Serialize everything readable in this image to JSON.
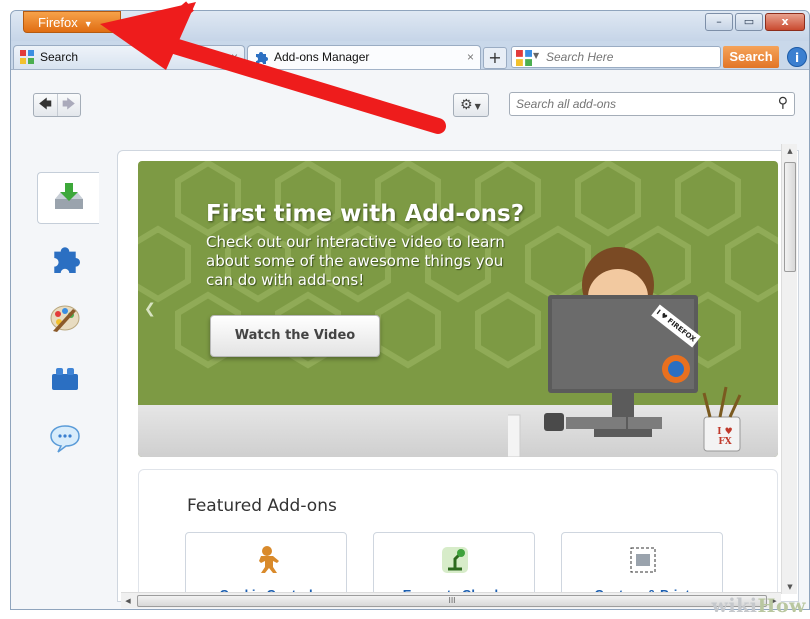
{
  "window": {
    "app_button_label": "Firefox",
    "controls": {
      "minimize": "–",
      "maximize": "▭",
      "close": "x"
    }
  },
  "tabs": [
    {
      "label": "Search",
      "active": false,
      "icon": "search-engine-icon"
    },
    {
      "label": "Add-ons Manager",
      "active": true,
      "icon": "puzzle-piece-icon"
    }
  ],
  "toolbar": {
    "search_placeholder": "Search Here",
    "search_button_label": "Search",
    "info_label": "i"
  },
  "addons": {
    "search_placeholder": "Search all add-ons",
    "categories": [
      {
        "name": "get-add-ons",
        "icon": "download-tray-icon",
        "selected": true
      },
      {
        "name": "extensions",
        "icon": "puzzle-piece-icon",
        "selected": false
      },
      {
        "name": "appearance",
        "icon": "palette-icon",
        "selected": false
      },
      {
        "name": "plugins",
        "icon": "lego-brick-icon",
        "selected": false
      },
      {
        "name": "services",
        "icon": "speech-bubble-icon",
        "selected": false
      }
    ],
    "banner": {
      "title": "First time with Add-ons?",
      "description": "Check out our interactive video to learn about some of the awesome things you can do with add-ons!",
      "button_label": "Watch the Video",
      "sticker_text": "I ♥ FIREFOX",
      "mug_text": "I ♥ FX"
    },
    "featured": {
      "heading": "Featured Add-ons",
      "items": [
        {
          "name": "Cookie Control",
          "icon": "gingerbread-icon"
        },
        {
          "name": "Evernote Clearly",
          "icon": "desk-lamp-icon"
        },
        {
          "name": "Capture & Print",
          "icon": "capture-icon"
        }
      ]
    },
    "scroll_grip": "III"
  },
  "watermark": {
    "wiki": "wiki",
    "how": "How"
  },
  "colors": {
    "firefox_orange": "#e8801f",
    "banner_green": "#7d9a44",
    "arrow_red": "#ee1c1c",
    "link_blue": "#1d5fb0"
  }
}
